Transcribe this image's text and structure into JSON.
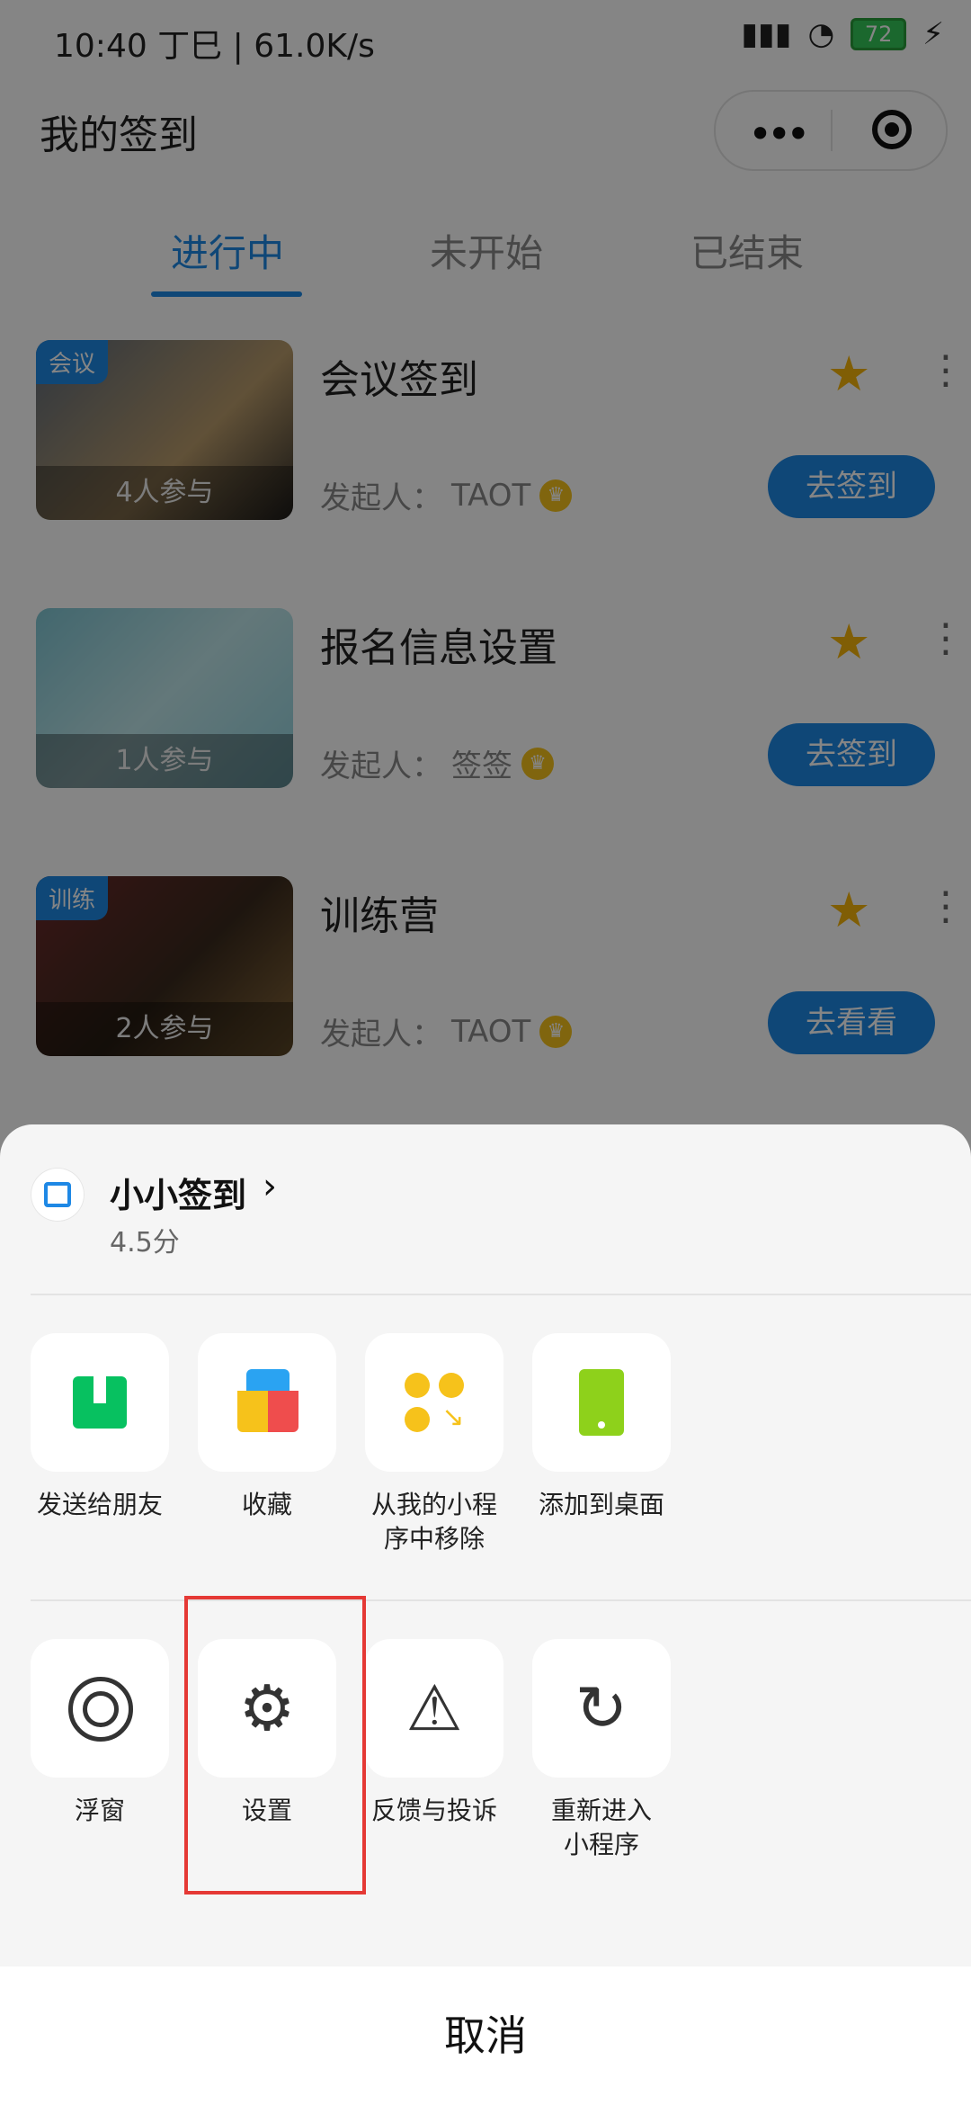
{
  "status": {
    "time": "10:40 丁巳 | 61.0K/s",
    "battery": "72"
  },
  "header": {
    "title": "我的签到"
  },
  "tabs": [
    {
      "label": "进行中",
      "active": true
    },
    {
      "label": "未开始",
      "active": false
    },
    {
      "label": "已结束",
      "active": false
    }
  ],
  "list": [
    {
      "tag": "会议",
      "title": "会议签到",
      "participants": "4人参与",
      "owner_label": "发起人：",
      "owner": "TAOT",
      "button": "去签到"
    },
    {
      "tag": "",
      "title": "报名信息设置",
      "participants": "1人参与",
      "owner_label": "发起人：",
      "owner": "签签",
      "button": "去签到"
    },
    {
      "tag": "训练",
      "title": "训练营",
      "participants": "2人参与",
      "owner_label": "发起人：",
      "owner": "TAOT",
      "button": "去看看"
    }
  ],
  "sheet": {
    "app_name": "小小签到",
    "score": "4.5分",
    "row1": [
      {
        "label": "发送给朋友",
        "icon": "share-icon"
      },
      {
        "label": "收藏",
        "icon": "favorite-cube-icon"
      },
      {
        "label": "从我的小程序中移除",
        "icon": "remove-from-my-miniprogram-icon"
      },
      {
        "label": "添加到桌面",
        "icon": "add-to-desktop-icon"
      }
    ],
    "row2": [
      {
        "label": "浮窗",
        "icon": "float-window-icon"
      },
      {
        "label": "设置",
        "icon": "gear-icon"
      },
      {
        "label": "反馈与投诉",
        "icon": "warning-icon"
      },
      {
        "label": "重新进入小程序",
        "icon": "reload-icon"
      }
    ],
    "cancel": "取消"
  },
  "colors": {
    "accent": "#1e88e5",
    "star": "#f6b40b",
    "highlight": "#e53935"
  }
}
